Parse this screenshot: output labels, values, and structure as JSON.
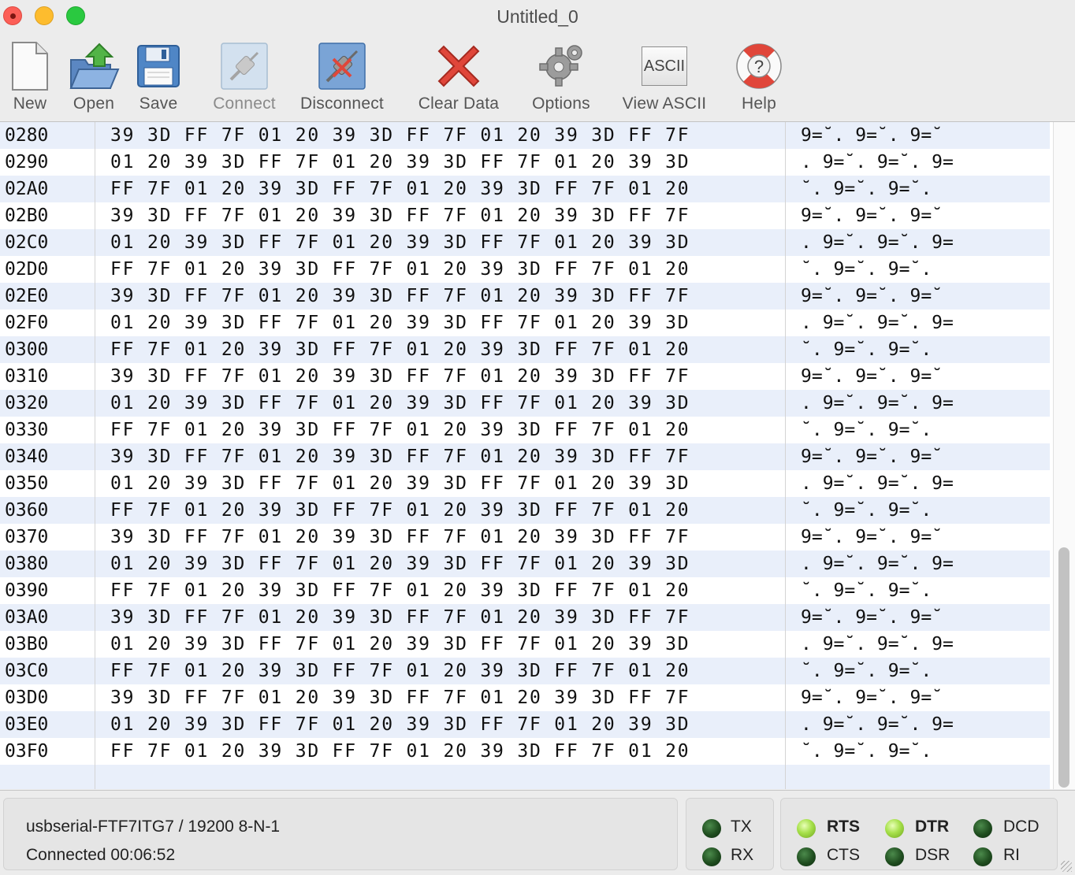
{
  "window": {
    "title": "Untitled_0"
  },
  "toolbar": {
    "items": [
      {
        "label": "New",
        "icon": "new-document-icon"
      },
      {
        "label": "Open",
        "icon": "open-folder-icon"
      },
      {
        "label": "Save",
        "icon": "floppy-disk-icon"
      },
      {
        "label": "Connect",
        "icon": "connect-plug-icon"
      },
      {
        "label": "Disconnect",
        "icon": "disconnect-plug-icon"
      },
      {
        "label": "Clear Data",
        "icon": "red-x-icon"
      },
      {
        "label": "Options",
        "icon": "gears-icon"
      },
      {
        "label": "View ASCII",
        "icon": "ascii-icon",
        "icon_text": "ASCII"
      },
      {
        "label": "Help",
        "icon": "lifebuoy-help-icon",
        "icon_text": "?"
      }
    ]
  },
  "hexview": {
    "rows": [
      {
        "addr": "0280",
        "hex": "39 3D FF 7F 01 20 39 3D FF 7F 01 20 39 3D FF 7F",
        "ascii": "9=˘. 9=˘. 9=˘"
      },
      {
        "addr": "0290",
        "hex": "01 20 39 3D FF 7F 01 20 39 3D FF 7F 01 20 39 3D",
        "ascii": ". 9=˘. 9=˘. 9="
      },
      {
        "addr": "02A0",
        "hex": "FF 7F 01 20 39 3D FF 7F 01 20 39 3D FF 7F 01 20",
        "ascii": "˘. 9=˘. 9=˘."
      },
      {
        "addr": "02B0",
        "hex": "39 3D FF 7F 01 20 39 3D FF 7F 01 20 39 3D FF 7F",
        "ascii": "9=˘. 9=˘. 9=˘"
      },
      {
        "addr": "02C0",
        "hex": "01 20 39 3D FF 7F 01 20 39 3D FF 7F 01 20 39 3D",
        "ascii": ". 9=˘. 9=˘. 9="
      },
      {
        "addr": "02D0",
        "hex": "FF 7F 01 20 39 3D FF 7F 01 20 39 3D FF 7F 01 20",
        "ascii": "˘. 9=˘. 9=˘."
      },
      {
        "addr": "02E0",
        "hex": "39 3D FF 7F 01 20 39 3D FF 7F 01 20 39 3D FF 7F",
        "ascii": "9=˘. 9=˘. 9=˘"
      },
      {
        "addr": "02F0",
        "hex": "01 20 39 3D FF 7F 01 20 39 3D FF 7F 01 20 39 3D",
        "ascii": ". 9=˘. 9=˘. 9="
      },
      {
        "addr": "0300",
        "hex": "FF 7F 01 20 39 3D FF 7F 01 20 39 3D FF 7F 01 20",
        "ascii": "˘. 9=˘. 9=˘."
      },
      {
        "addr": "0310",
        "hex": "39 3D FF 7F 01 20 39 3D FF 7F 01 20 39 3D FF 7F",
        "ascii": "9=˘. 9=˘. 9=˘"
      },
      {
        "addr": "0320",
        "hex": "01 20 39 3D FF 7F 01 20 39 3D FF 7F 01 20 39 3D",
        "ascii": ". 9=˘. 9=˘. 9="
      },
      {
        "addr": "0330",
        "hex": "FF 7F 01 20 39 3D FF 7F 01 20 39 3D FF 7F 01 20",
        "ascii": "˘. 9=˘. 9=˘."
      },
      {
        "addr": "0340",
        "hex": "39 3D FF 7F 01 20 39 3D FF 7F 01 20 39 3D FF 7F",
        "ascii": "9=˘. 9=˘. 9=˘"
      },
      {
        "addr": "0350",
        "hex": "01 20 39 3D FF 7F 01 20 39 3D FF 7F 01 20 39 3D",
        "ascii": ". 9=˘. 9=˘. 9="
      },
      {
        "addr": "0360",
        "hex": "FF 7F 01 20 39 3D FF 7F 01 20 39 3D FF 7F 01 20",
        "ascii": "˘. 9=˘. 9=˘."
      },
      {
        "addr": "0370",
        "hex": "39 3D FF 7F 01 20 39 3D FF 7F 01 20 39 3D FF 7F",
        "ascii": "9=˘. 9=˘. 9=˘"
      },
      {
        "addr": "0380",
        "hex": "01 20 39 3D FF 7F 01 20 39 3D FF 7F 01 20 39 3D",
        "ascii": ". 9=˘. 9=˘. 9="
      },
      {
        "addr": "0390",
        "hex": "FF 7F 01 20 39 3D FF 7F 01 20 39 3D FF 7F 01 20",
        "ascii": "˘. 9=˘. 9=˘."
      },
      {
        "addr": "03A0",
        "hex": "39 3D FF 7F 01 20 39 3D FF 7F 01 20 39 3D FF 7F",
        "ascii": "9=˘. 9=˘. 9=˘"
      },
      {
        "addr": "03B0",
        "hex": "01 20 39 3D FF 7F 01 20 39 3D FF 7F 01 20 39 3D",
        "ascii": ". 9=˘. 9=˘. 9="
      },
      {
        "addr": "03C0",
        "hex": "FF 7F 01 20 39 3D FF 7F 01 20 39 3D FF 7F 01 20",
        "ascii": "˘. 9=˘. 9=˘."
      },
      {
        "addr": "03D0",
        "hex": "39 3D FF 7F 01 20 39 3D FF 7F 01 20 39 3D FF 7F",
        "ascii": "9=˘. 9=˘. 9=˘"
      },
      {
        "addr": "03E0",
        "hex": "01 20 39 3D FF 7F 01 20 39 3D FF 7F 01 20 39 3D",
        "ascii": ". 9=˘. 9=˘. 9="
      },
      {
        "addr": "03F0",
        "hex": "FF 7F 01 20 39 3D FF 7F 01 20 39 3D FF 7F 01 20",
        "ascii": "˘. 9=˘. 9=˘."
      }
    ]
  },
  "status": {
    "port": "usbserial-FTF7ITG7 / 19200 8-N-1",
    "connection": "Connected 00:06:52",
    "lines": [
      {
        "label": "TX",
        "on": false,
        "bold": false
      },
      {
        "label": "RX",
        "on": false,
        "bold": false
      },
      {
        "label": "RTS",
        "on": true,
        "bold": true
      },
      {
        "label": "CTS",
        "on": false,
        "bold": false
      },
      {
        "label": "DTR",
        "on": true,
        "bold": true
      },
      {
        "label": "DSR",
        "on": false,
        "bold": false
      },
      {
        "label": "DCD",
        "on": false,
        "bold": false
      },
      {
        "label": "RI",
        "on": false,
        "bold": false
      }
    ]
  },
  "colors": {
    "row_stripe": "#e9effa",
    "led_on": "#a6e04a",
    "led_off": "#1f4d1f"
  }
}
